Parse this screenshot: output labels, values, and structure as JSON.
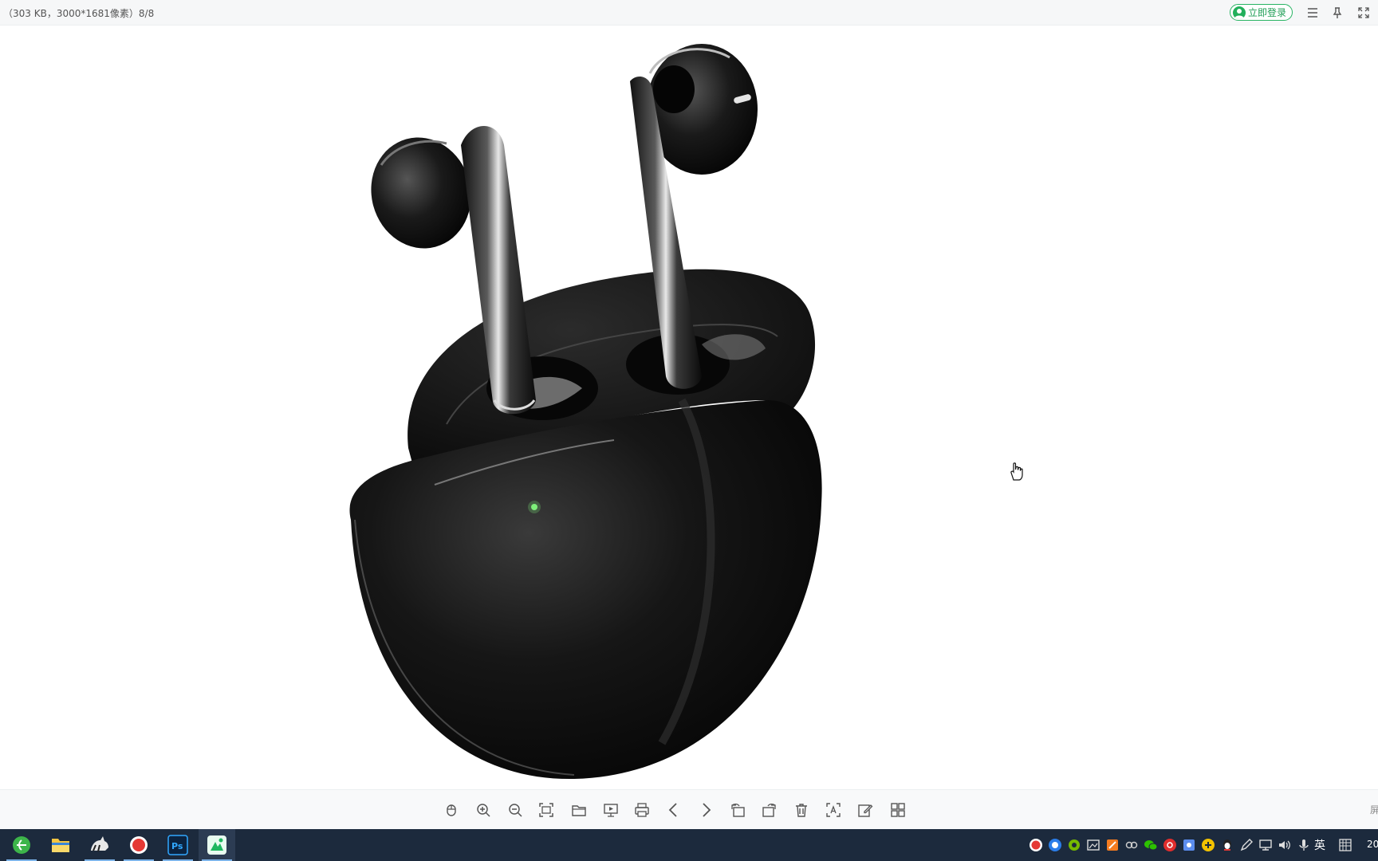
{
  "titlebar": {
    "file_info": "（303 KB，3000*1681像素）8/8",
    "login_label": "立即登录"
  },
  "toolbar": {
    "edge_text": "屏"
  },
  "taskbar": {
    "ime_label": "英",
    "clock_fragment": "20"
  },
  "colors": {
    "accent_green": "#22b05b",
    "taskbar_bg": "#1c2a3d",
    "toolbar_icon": "#555555"
  }
}
